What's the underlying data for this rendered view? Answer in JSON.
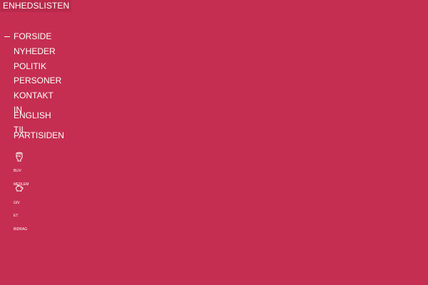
{
  "brand": {
    "logo_text": "ENHEDSLISTEN"
  },
  "nav": {
    "active_marker": "—",
    "items": [
      {
        "label": "FORSIDE"
      },
      {
        "label": "NYHEDER"
      },
      {
        "label": "POLITIK"
      },
      {
        "label": "PERSONER"
      },
      {
        "label": "KONTAKT"
      },
      {
        "label_a": "IN",
        "label_b": "ENGLISH"
      },
      {
        "label_a": "TIL",
        "label_b": "PARTISIDEN"
      }
    ]
  },
  "actions": {
    "join": {
      "icon": "raised-fist-icon",
      "line1": "BLIV",
      "line2": "MEDLEM"
    },
    "donate": {
      "icon": "piggy-bank-icon",
      "line1": "GIV",
      "line2": "ET",
      "line3": "BIDRAG"
    }
  },
  "colors": {
    "background": "#c52e50",
    "logo_background": "#b8294a",
    "text": "#ffffff"
  }
}
